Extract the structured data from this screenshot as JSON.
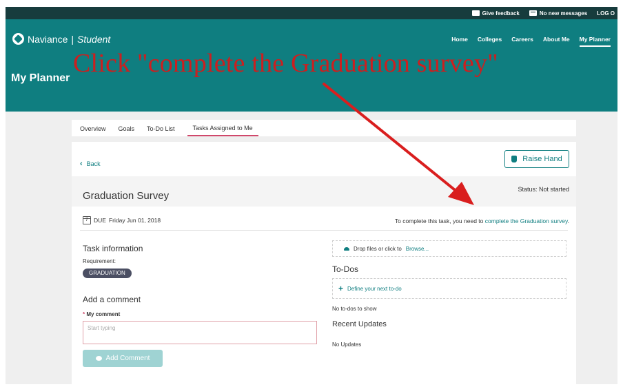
{
  "topbar": {
    "feedback": "Give feedback",
    "messages": "No new messages",
    "logout": "LOG O"
  },
  "brand": {
    "name": "Naviance",
    "separator": "|",
    "product": "Student"
  },
  "nav": {
    "items": [
      {
        "label": "Home"
      },
      {
        "label": "Colleges"
      },
      {
        "label": "Careers"
      },
      {
        "label": "About Me"
      },
      {
        "label": "My Planner",
        "active": true
      }
    ]
  },
  "page": {
    "title": "My Planner"
  },
  "annotation": {
    "text": "Click \"complete the Graduation survey\"",
    "color": "#cc1f1f"
  },
  "tabs": [
    {
      "label": "Overview"
    },
    {
      "label": "Goals"
    },
    {
      "label": "To-Do List"
    },
    {
      "label": "Tasks Assigned to Me",
      "active": true
    }
  ],
  "card": {
    "back_label": "Back",
    "raise_hand_label": "Raise Hand",
    "task_title": "Graduation Survey",
    "status": "Status: Not started",
    "calendar_day": "7",
    "due_prefix": "DUE",
    "due_date": "Friday Jun 01, 2018",
    "instruction_prefix": "To complete this task, you need to",
    "instruction_link": "complete the Graduation survey",
    "instruction_suffix": ".",
    "task_info_heading": "Task information",
    "requirement_label": "Requirement:",
    "requirement_value": "GRADUATION",
    "comment_heading": "Add a comment",
    "comment_required_mark": "*",
    "comment_label": "My comment",
    "comment_placeholder": "Start typing",
    "add_comment_label": "Add Comment",
    "drop_text": "Drop files or click to",
    "browse_link": "Browse...",
    "todos_heading": "To-Dos",
    "define_todo": "Define your next to-do",
    "no_todos": "No to-dos to show",
    "recent_heading": "Recent Updates",
    "no_updates": "No Updates"
  },
  "colors": {
    "brand_teal": "#0f7e80",
    "topbar": "#173c3d",
    "accent_pink": "#d0486b"
  }
}
